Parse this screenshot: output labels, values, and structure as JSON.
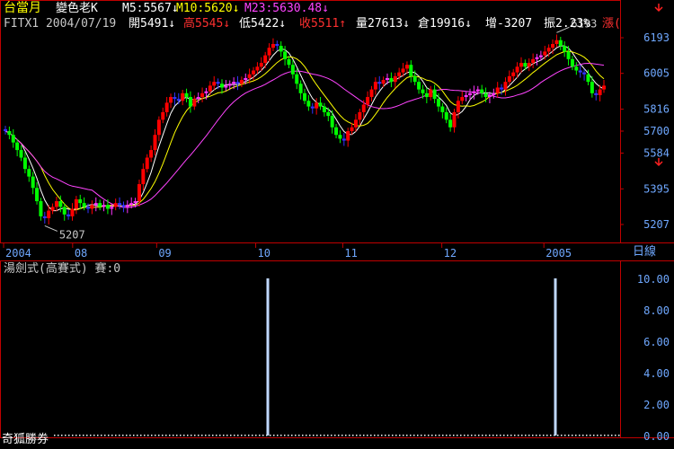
{
  "header": {
    "title": "台當月",
    "view_mode": "變色老K",
    "ma5": "M5:5567↓",
    "ma10": "M10:5620↓",
    "ma23": "M23:5630.48↓",
    "alert_icon": "down-arrow-icon"
  },
  "info": {
    "symbol_date": "FITX1 2004/07/19",
    "open": "開5491↓",
    "high": "高5545↓",
    "low": "低5422↓",
    "close": "收5511↑",
    "volume": "量27613↓",
    "open_interest": "倉19916↓",
    "change": "增-3207",
    "amplitude": "振2.23%",
    "change_pct_partial": "漲("
  },
  "period_label": "日線",
  "indicator": {
    "title": "湯劍式(高賽式) 賽:0",
    "footer": "奇狐勝券"
  },
  "colors": {
    "up_strong": "#ff0000",
    "up_mid": "#ff33ff",
    "down_mid": "#3333ff",
    "down_strong": "#00ff00",
    "ma5": "#ffffff",
    "ma10": "#ffff00",
    "ma23": "#ff44ff",
    "axis_frame": "#c00000",
    "axis_text": "#6fa8ff",
    "spike": "#c0d8ff"
  },
  "chart_data": [
    {
      "type": "candlestick",
      "x_tick_labels": [
        "2004",
        "08",
        "09",
        "10",
        "11",
        "12",
        "2005"
      ],
      "y_tick_labels": [
        5207,
        5395,
        5584,
        5700,
        5816,
        6005,
        6193
      ],
      "annotations": [
        {
          "label": "5207",
          "kind": "low"
        },
        {
          "label": "6193",
          "kind": "high"
        }
      ],
      "series": [
        {
          "name": "M5",
          "color": "#ffffff"
        },
        {
          "name": "M10",
          "color": "#ffff00"
        },
        {
          "name": "M23",
          "color": "#ff44ff"
        }
      ],
      "closes": [
        5700,
        5680,
        5640,
        5600,
        5560,
        5500,
        5460,
        5400,
        5330,
        5250,
        5240,
        5280,
        5300,
        5330,
        5300,
        5260,
        5250,
        5290,
        5340,
        5320,
        5300,
        5290,
        5310,
        5320,
        5300,
        5310,
        5290,
        5300,
        5320,
        5310,
        5300,
        5310,
        5320,
        5330,
        5420,
        5500,
        5560,
        5600,
        5680,
        5760,
        5800,
        5850,
        5880,
        5870,
        5860,
        5900,
        5880,
        5830,
        5870,
        5880,
        5900,
        5910,
        5940,
        5960,
        5950,
        5930,
        5940,
        5950,
        5960,
        5950,
        5970,
        5980,
        6000,
        6020,
        6040,
        6060,
        6100,
        6140,
        6160,
        6150,
        6120,
        6080,
        6050,
        6000,
        5950,
        5900,
        5860,
        5830,
        5820,
        5850,
        5830,
        5800,
        5780,
        5720,
        5680,
        5660,
        5650,
        5700,
        5720,
        5760,
        5800,
        5840,
        5880,
        5920,
        5960,
        5950,
        5970,
        5980,
        5960,
        5990,
        6010,
        6030,
        6050,
        5990,
        5960,
        5920,
        5900,
        5880,
        5920,
        5870,
        5830,
        5800,
        5760,
        5720,
        5800,
        5860,
        5880,
        5890,
        5900,
        5910,
        5920,
        5900,
        5880,
        5890,
        5900,
        5930,
        5920,
        5960,
        5990,
        6010,
        6040,
        6060,
        6040,
        6060,
        6080,
        6090,
        6100,
        6120,
        6140,
        6160,
        6180,
        6150,
        6120,
        6080,
        6040,
        6020,
        6010,
        6000,
        5960,
        5900,
        5890,
        5920,
        5940
      ]
    },
    {
      "type": "bar",
      "y_tick_labels": [
        "0.00",
        "2.00",
        "4.00",
        "6.00",
        "8.00",
        "10.00"
      ],
      "ylim": [
        0,
        10
      ],
      "spikes": [
        {
          "x_label": "10",
          "value": 10
        },
        {
          "x_label": "2005",
          "value": 10
        }
      ]
    }
  ]
}
